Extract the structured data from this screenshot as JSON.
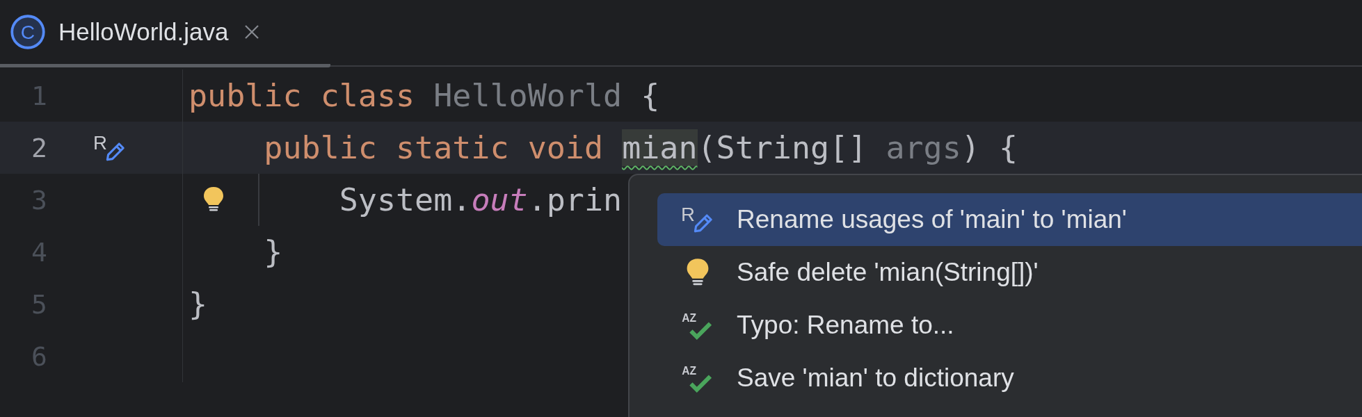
{
  "tab": {
    "title": "HelloWorld.java",
    "selected": true,
    "icon_text": "C"
  },
  "lines": [
    {
      "number": "1",
      "current": false,
      "tokens": [
        {
          "kind": "keyword",
          "text": "public class "
        },
        {
          "kind": "unused",
          "text": "HelloWorld"
        },
        {
          "kind": "plain",
          "text": " {"
        }
      ]
    },
    {
      "number": "2",
      "current": true,
      "marker": {
        "kind": "rename",
        "icon_text": "R"
      },
      "tokens": [
        {
          "kind": "keyword",
          "text": "    public static void "
        },
        {
          "kind": "typo",
          "text": "mian"
        },
        {
          "kind": "plain",
          "text": "(String[] "
        },
        {
          "kind": "unused",
          "text": "args"
        },
        {
          "kind": "plain",
          "text": ") {"
        }
      ]
    },
    {
      "number": "3",
      "current": false,
      "marker": {
        "kind": "bulb"
      },
      "tokens": [
        {
          "kind": "plain",
          "text": "        System."
        },
        {
          "kind": "static-field",
          "text": "out"
        },
        {
          "kind": "plain",
          "text": ".prin"
        }
      ]
    },
    {
      "number": "4",
      "current": false,
      "tokens": [
        {
          "kind": "plain",
          "text": "    }"
        }
      ]
    },
    {
      "number": "5",
      "current": false,
      "tokens": [
        {
          "kind": "plain",
          "text": "}"
        }
      ]
    },
    {
      "number": "6",
      "current": false
    }
  ],
  "popup": {
    "items": [
      {
        "kind": "rename",
        "icon_text": "R",
        "label": "Rename usages of 'main' to 'mian'",
        "selected": true
      },
      {
        "kind": "bulb",
        "label": "Safe delete 'mian(String[])'",
        "selected": false
      },
      {
        "kind": "spell",
        "icon_text": "AZ",
        "label": "Typo: Rename to...",
        "selected": false
      },
      {
        "kind": "spell",
        "icon_text": "AZ",
        "label": "Save 'mian' to dictionary",
        "selected": false
      }
    ]
  }
}
